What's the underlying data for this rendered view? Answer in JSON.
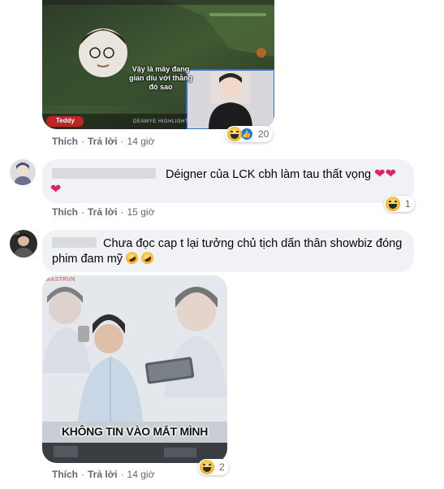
{
  "comments": [
    {
      "actions": {
        "like": "Thích",
        "reply": "Trả lời",
        "time": "14 giờ"
      },
      "reaction_count": "20",
      "media": {
        "caption": "Vậy là mày đang\ngian díu với thằng đó sao",
        "caption_line1": "Vậy là mày đang",
        "caption_line2": "gian díu với thằng đó sao",
        "streamer_tag": "Teddy",
        "overlay_text": "DEAWYE HIGHLIGHT"
      }
    },
    {
      "text": "Déigner của LCK cbh làm tau thất vọng",
      "actions": {
        "like": "Thích",
        "reply": "Trả lời",
        "time": "15 giờ"
      },
      "reaction_count": "1"
    },
    {
      "text_line1": "Chưa đọc cap t lại tưởng chủ tịch dấn thân showbiz đóng",
      "text_line2": "phim đam mỹ",
      "actions": {
        "like": "Thích",
        "reply": "Trả lời",
        "time": "14 giờ"
      },
      "reaction_count": "2",
      "media": {
        "watermark": "MASTRVN",
        "caption": "KHÔNG TIN VÀO MẮT MÌNH"
      }
    }
  ],
  "colors": {
    "meta_text": "#65676b",
    "bubble_bg": "#f0f2f5",
    "heart": "#e0245e",
    "like_blue": "#1877f2"
  },
  "icons": [
    "haha-reaction-icon",
    "like-reaction-icon",
    "heart-emoji-icon",
    "rofl-emoji-icon"
  ]
}
